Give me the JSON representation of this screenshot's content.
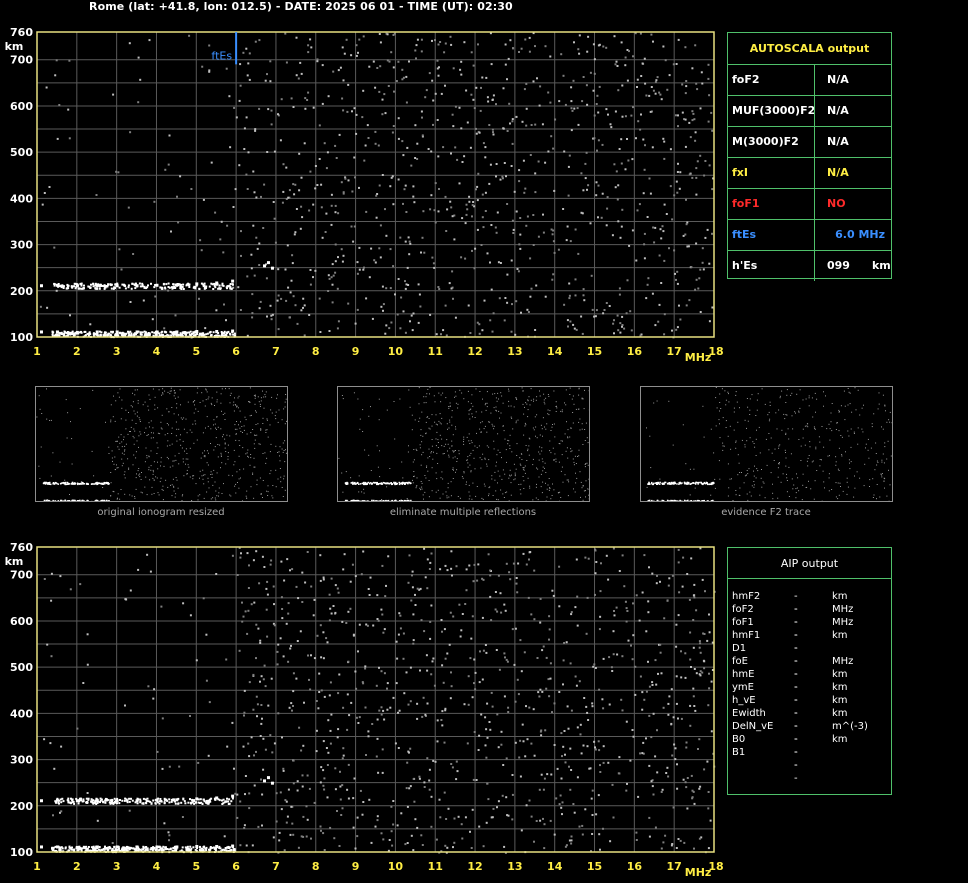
{
  "header": {
    "text": "Rome (lat: +41.8, lon: 012.5) - DATE: 2025 06 01 - TIME (UT): 02:30"
  },
  "ionogram": {
    "x_ticks": [
      "1",
      "2",
      "3",
      "4",
      "5",
      "6",
      "7",
      "8",
      "9",
      "10",
      "11",
      "12",
      "13",
      "14",
      "15",
      "16",
      "17",
      "18"
    ],
    "x_unit": "MHz",
    "y_ticks": [
      "100",
      "200",
      "300",
      "400",
      "500",
      "600",
      "700"
    ],
    "y_top_label": "760",
    "y_unit": "km",
    "es_marker": {
      "label": "ftEs",
      "freq_mhz": 6.0
    }
  },
  "autoscala": {
    "title": "AUTOSCALA output",
    "rows": [
      {
        "key": "foF2",
        "value": "N/A",
        "color": "#ffffff"
      },
      {
        "key": "MUF(3000)F2",
        "value": "N/A",
        "color": "#ffffff"
      },
      {
        "key": "M(3000)F2",
        "value": "N/A",
        "color": "#ffffff"
      },
      {
        "key": "fxI",
        "value": "N/A",
        "color": "#ffee44"
      },
      {
        "key": "foF1",
        "value": "NO",
        "color": "#ff2a2a"
      },
      {
        "key": "ftEs",
        "value": "6.0 MHz",
        "color": "#3a8fff"
      },
      {
        "key": "h'Es",
        "value": "099",
        "unit": "km",
        "color": "#ffffff"
      }
    ]
  },
  "thumbnails": [
    {
      "caption": "original ionogram resized"
    },
    {
      "caption": "eliminate multiple reflections"
    },
    {
      "caption": "evidence F2 trace"
    }
  ],
  "aip": {
    "title": "AIP output",
    "rows": [
      {
        "key": "hmF2",
        "value": "---",
        "unit": "km"
      },
      {
        "key": "foF2",
        "value": "---",
        "unit": "MHz"
      },
      {
        "key": "foF1",
        "value": "---",
        "unit": "MHz"
      },
      {
        "key": "hmF1",
        "value": "---",
        "unit": "km"
      },
      {
        "key": "D1",
        "value": "---",
        "unit": ""
      },
      {
        "key": "foE",
        "value": "---",
        "unit": "MHz"
      },
      {
        "key": "hmE",
        "value": "---",
        "unit": "km"
      },
      {
        "key": "ymE",
        "value": "---",
        "unit": "km"
      },
      {
        "key": "h_vE",
        "value": "---",
        "unit": "km"
      },
      {
        "key": "Ewidth",
        "value": "---",
        "unit": "km"
      },
      {
        "key": "DelN_vE",
        "value": "---",
        "unit": "m^(-3)"
      },
      {
        "key": "B0",
        "value": "---",
        "unit": "km"
      },
      {
        "key": "B1",
        "value": "---",
        "unit": ""
      }
    ]
  },
  "chart_data": [
    {
      "type": "scatter",
      "title": "",
      "xlabel": "MHz",
      "ylabel": "km",
      "xlim": [
        1,
        18
      ],
      "ylim": [
        100,
        760
      ],
      "grid": true,
      "series": [
        {
          "values": [
            [
              1.1,
              112
            ],
            [
              1.5,
              112
            ],
            [
              2.0,
              111
            ],
            [
              2.5,
              112
            ],
            [
              3.0,
              112
            ],
            [
              3.5,
              112
            ],
            [
              4.0,
              112
            ],
            [
              4.5,
              112
            ],
            [
              5.0,
              113
            ],
            [
              5.5,
              113
            ],
            [
              5.9,
              114
            ],
            [
              1.1,
              212
            ],
            [
              1.5,
              213
            ],
            [
              2.0,
              212
            ],
            [
              2.5,
              213
            ],
            [
              3.0,
              212
            ],
            [
              3.5,
              212
            ],
            [
              4.0,
              213
            ],
            [
              4.5,
              214
            ],
            [
              5.0,
              216
            ],
            [
              5.5,
              218
            ],
            [
              5.9,
              222
            ],
            [
              6.7,
              255
            ],
            [
              6.8,
              262
            ],
            [
              6.9,
              250
            ]
          ]
        },
        {
          "values": [
            [
              6.0,
              100
            ],
            [
              6.0,
              760
            ]
          ]
        }
      ]
    },
    {
      "type": "scatter",
      "title": "",
      "xlabel": "MHz",
      "ylabel": "km",
      "xlim": [
        1,
        18
      ],
      "ylim": [
        100,
        760
      ],
      "grid": true,
      "series": [
        {
          "values": [
            [
              1.1,
              112
            ],
            [
              1.5,
              112
            ],
            [
              2.0,
              111
            ],
            [
              2.5,
              112
            ],
            [
              3.0,
              112
            ],
            [
              3.5,
              112
            ],
            [
              4.0,
              112
            ],
            [
              4.5,
              112
            ],
            [
              5.0,
              113
            ],
            [
              5.5,
              113
            ],
            [
              5.9,
              114
            ],
            [
              1.1,
              212
            ],
            [
              1.5,
              213
            ],
            [
              2.0,
              212
            ],
            [
              2.5,
              213
            ],
            [
              3.0,
              212
            ],
            [
              3.5,
              212
            ],
            [
              4.0,
              213
            ],
            [
              4.5,
              214
            ],
            [
              5.0,
              216
            ],
            [
              5.5,
              218
            ],
            [
              5.9,
              222
            ],
            [
              6.7,
              255
            ],
            [
              6.8,
              262
            ],
            [
              6.9,
              250
            ]
          ]
        }
      ]
    }
  ]
}
